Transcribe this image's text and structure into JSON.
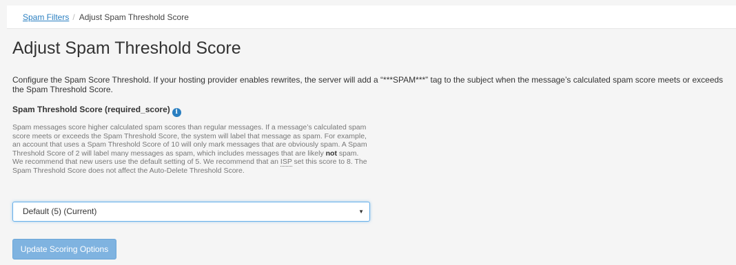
{
  "breadcrumb": {
    "parent_link": "Spam Filters",
    "separator": "/",
    "current": "Adjust Spam Threshold Score"
  },
  "page_title": "Adjust Spam Threshold Score",
  "intro_text": "Configure the Spam Score Threshold. If your hosting provider enables rewrites, the server will add a “***SPAM***” tag to the subject when the message’s calculated spam score meets or exceeds the Spam Threshold Score.",
  "field": {
    "label": "Spam Threshold Score (required_score)",
    "info_icon": "info-circle-icon",
    "help_part1": "Spam messages score higher calculated spam scores than regular messages. If a message’s calculated spam score meets or exceeds the Spam Threshold Score, the system will label that message as spam. For example, an account that uses a Spam Threshold Score of 10 will only mark messages that are obviously spam. A Spam Threshold Score of 2 will label many messages as spam, which includes messages that are likely ",
    "help_bold": "not",
    "help_part2": " spam. We recommend that new users use the default setting of 5. We recommend that an ",
    "help_abbr": "ISP",
    "help_part3": " set this score to 8. The Spam Threshold Score does not affect the Auto-Delete Threshold Score."
  },
  "select": {
    "selected": "Default (5) (Current)",
    "arrow_icon": "caret-down-icon"
  },
  "update_button": {
    "label": "Update Scoring Options"
  },
  "colors": {
    "link": "#2a7fc1",
    "button_bg": "#7fb3e0",
    "focus_border": "#66afe9",
    "page_bg": "#f5f5f5"
  }
}
